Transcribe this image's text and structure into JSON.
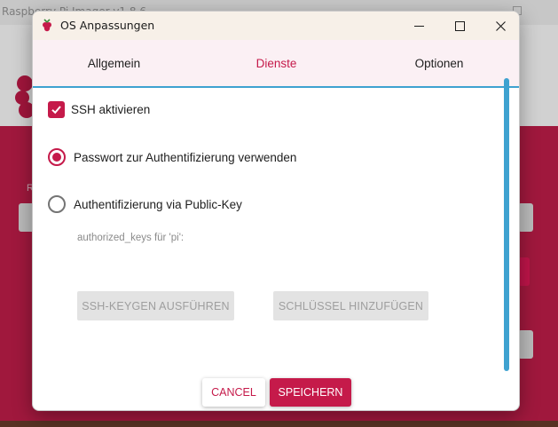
{
  "background_app": {
    "title": "Raspberry Pi Imager v1.8.6"
  },
  "dialog": {
    "title": "OS Anpassungen",
    "tabs": [
      {
        "label": "Allgemein",
        "active": false
      },
      {
        "label": "Dienste",
        "active": true
      },
      {
        "label": "Optionen",
        "active": false
      }
    ],
    "ssh_checkbox": {
      "label": "SSH aktivieren",
      "checked": true
    },
    "auth_options": [
      {
        "label": "Passwort zur Authentifizierung verwenden",
        "selected": true
      },
      {
        "label": "Authentifizierung via Public-Key",
        "selected": false
      }
    ],
    "authorized_keys_label": "authorized_keys für 'pi':",
    "buttons": {
      "keygen": "SSH-KEYGEN AUSFÜHREN",
      "add_key": "SCHLÜSSEL HINZUFÜGEN",
      "cancel": "CANCEL",
      "save": "SPEICHERN"
    }
  },
  "colors": {
    "accent": "#c51a4a",
    "tab_indicator": "#3fa2d0",
    "titlebar": "#f7f0e8",
    "tabs_background": "#fbf0f4",
    "disabled_button": "#e3e3e3",
    "background_app_main": "#c41e4b"
  },
  "icons": {
    "app": "raspberry-icon",
    "minimize": "minimize-icon",
    "maximize": "maximize-icon",
    "close": "close-icon",
    "checkbox": "checkmark-icon"
  }
}
